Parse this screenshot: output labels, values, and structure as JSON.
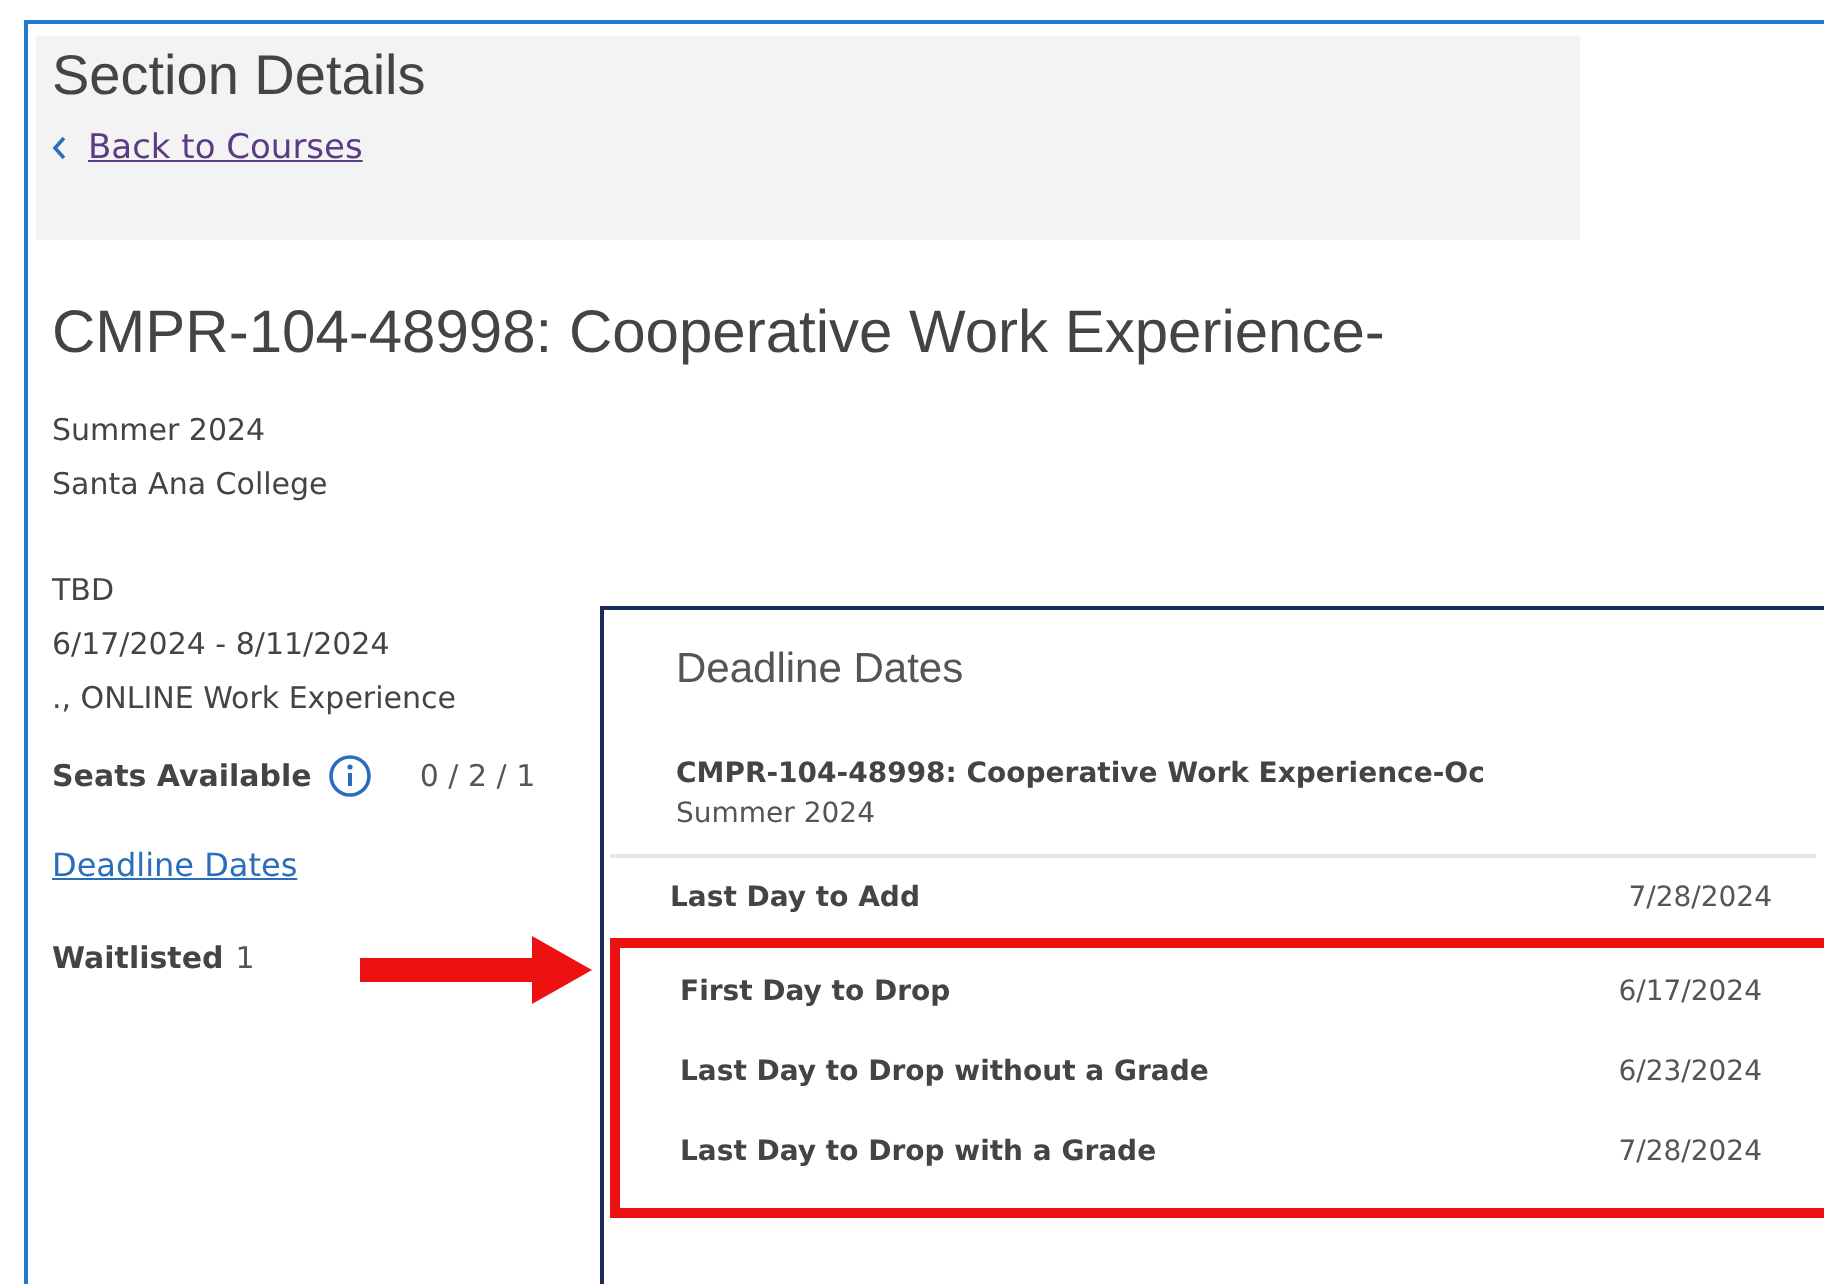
{
  "header": {
    "title": "Section Details",
    "back_link": "Back to Courses"
  },
  "section": {
    "title": "CMPR-104-48998: Cooperative Work Experience-",
    "term": "Summer 2024",
    "campus": "Santa Ana College",
    "instructor": "TBD",
    "dates": "6/17/2024 - 8/11/2024",
    "location": "., ONLINE Work Experience",
    "seats_label": "Seats Available",
    "seats_value": "0 / 2 / 1",
    "deadline_link": "Deadline Dates",
    "waitlisted_label": "Waitlisted",
    "waitlisted_value": "1"
  },
  "dialog": {
    "title": "Deadline Dates",
    "course": "CMPR-104-48998: Cooperative Work Experience-Oc",
    "term": "Summer 2024",
    "deadlines": [
      {
        "label": "Last Day to Add",
        "date": "7/28/2024",
        "highlighted": false
      },
      {
        "label": "First Day to Drop",
        "date": "6/17/2024",
        "highlighted": true
      },
      {
        "label": "Last Day to Drop without a Grade",
        "date": "6/23/2024",
        "highlighted": true
      },
      {
        "label": "Last Day to Drop with a Grade",
        "date": "7/28/2024",
        "highlighted": true
      }
    ]
  }
}
